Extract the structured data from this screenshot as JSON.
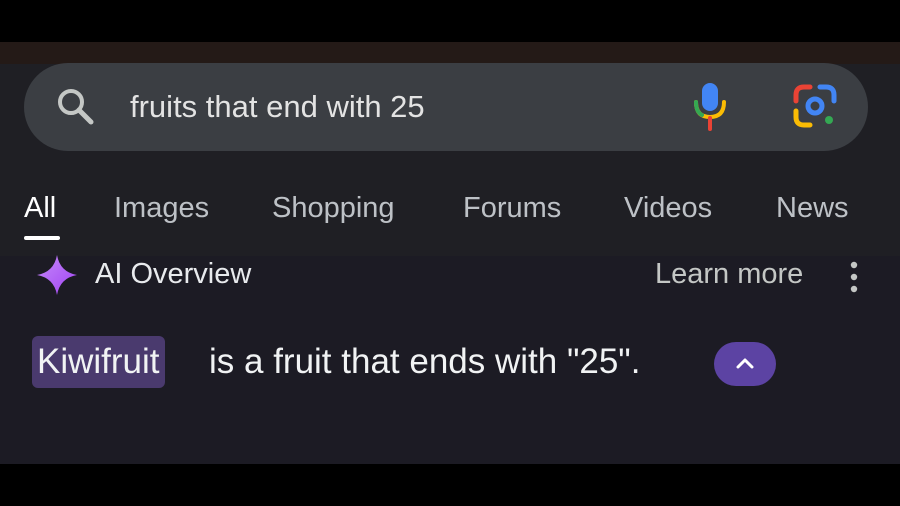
{
  "search": {
    "query": "fruits that end with 25",
    "icons": {
      "left": "search-icon",
      "voice": "microphone-icon",
      "lens": "google-lens-icon"
    }
  },
  "tabs": [
    {
      "label": "All",
      "active": true
    },
    {
      "label": "Images",
      "active": false
    },
    {
      "label": "Shopping",
      "active": false
    },
    {
      "label": "Forums",
      "active": false
    },
    {
      "label": "Videos",
      "active": false
    },
    {
      "label": "News",
      "active": false
    }
  ],
  "ai_overview": {
    "title": "AI Overview",
    "learn_more": "Learn more",
    "highlight": "Kiwifruit",
    "answer_rest": "is a fruit that ends with \"25\".",
    "icons": {
      "sparkle": "sparkle-icon",
      "more": "more-vert-icon",
      "collapse": "chevron-up-icon"
    }
  },
  "colors": {
    "background": "#1f1f24",
    "search_bar": "#3b3e43",
    "highlight": "#4a3a6e",
    "collapse_button": "#5c43a3",
    "google_blue": "#4285f4",
    "google_red": "#ea4335",
    "google_yellow": "#fbbc04",
    "google_green": "#34a853"
  }
}
